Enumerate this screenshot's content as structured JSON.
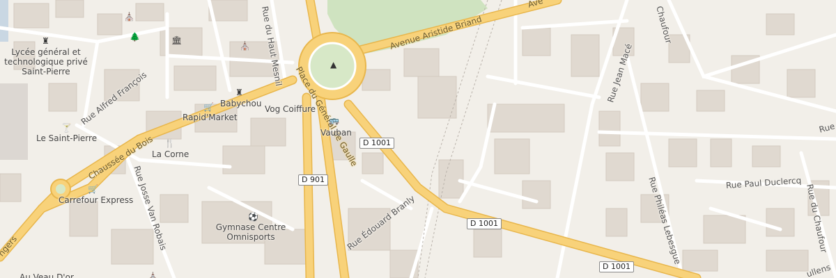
{
  "map": {
    "colors": {
      "background": "#f2efe9",
      "building": "#e0d9d0",
      "building_stroke": "#d3cabf",
      "major_road": "#f8d27a",
      "major_road_casing": "#e8b64c",
      "minor_road": "#ffffff",
      "park": "#cfe3c0",
      "rail": "#b9b2aa"
    },
    "places": [
      {
        "label": "Lycée général et technologique privé Saint-Pierre",
        "icon": "school-icon"
      },
      {
        "label": "Babychou",
        "icon": "school-icon"
      },
      {
        "label": "Rapid'Market",
        "icon": "shop-icon"
      },
      {
        "label": "Vog Coiffure",
        "icon": ""
      },
      {
        "label": "Vauban",
        "icon": "bus-stop-icon"
      },
      {
        "label": "Le Saint-Pierre",
        "icon": "bar-icon"
      },
      {
        "label": "La Corne",
        "icon": "restaurant-icon"
      },
      {
        "label": "Carrefour Express",
        "icon": "shop-icon"
      },
      {
        "label": "Gymnase Centre Omnisports",
        "icon": "sports-icon"
      },
      {
        "label": "Au Veau D'or",
        "icon": ""
      }
    ],
    "streets": [
      "Avenue Aristide Briand",
      "Place du Général de Gaulle",
      "Rue du Haut Mesnil",
      "Rue Alfred François",
      "Chaussée du Bois",
      "Rue Josse Van Robais",
      "Rue Édouard Branly",
      "Rue Jean Macé",
      "Rue Philéas Lebesgue",
      "Rue Paul Duclercq",
      "Rue du Chaufour",
      "Chaufour",
      "Rue",
      "ngers",
      "ullens",
      "Ave"
    ],
    "road_refs": [
      "D 1001",
      "D 1001",
      "D 1001",
      "D 901"
    ],
    "symbols": [
      "religious-icon",
      "tree-icon",
      "townhall-icon",
      "religious-icon",
      "monument-icon",
      "chapel-icon"
    ]
  }
}
